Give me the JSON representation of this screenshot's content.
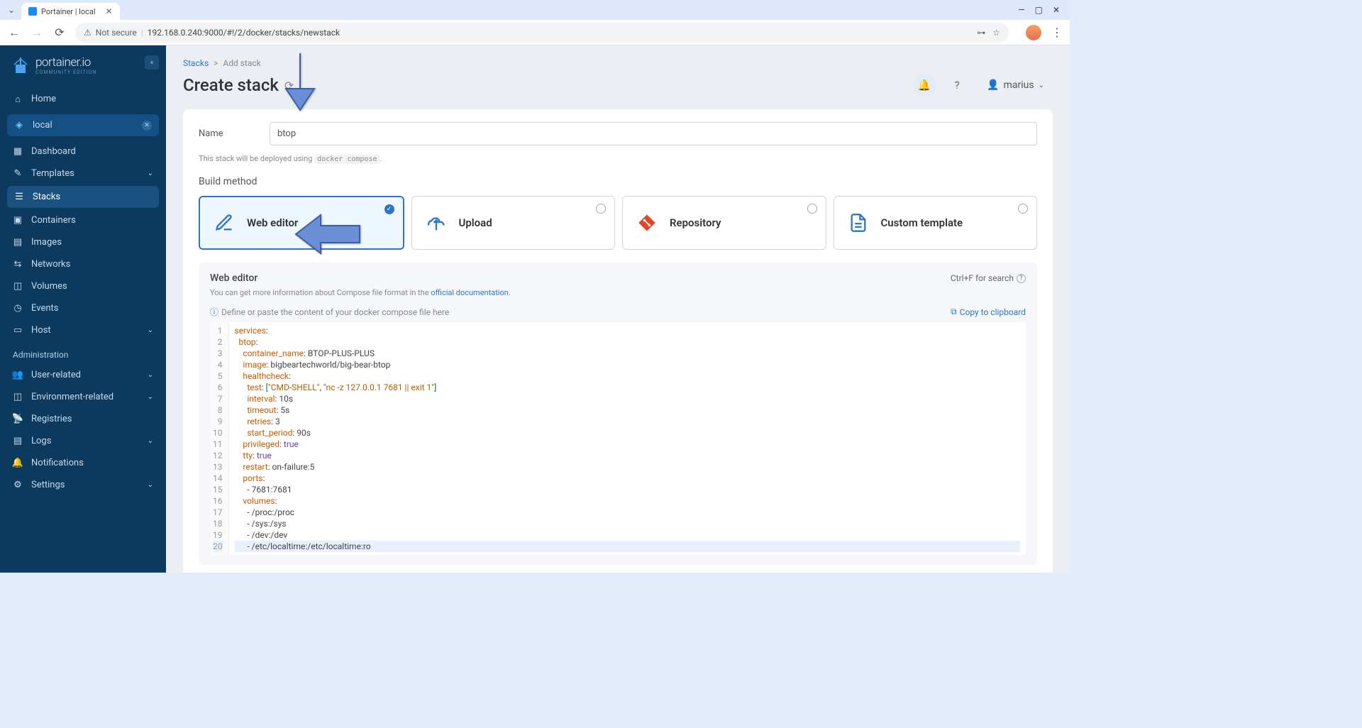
{
  "browser": {
    "tab_title": "Portainer | local",
    "security_label": "Not secure",
    "url": "192.168.0.240:9000/#!/2/docker/stacks/newstack"
  },
  "sidebar": {
    "brand": "portainer.io",
    "brand_sub": "COMMUNITY EDITION",
    "home": "Home",
    "env_name": "local",
    "items": [
      {
        "icon": "grid",
        "label": "Dashboard"
      },
      {
        "icon": "edit",
        "label": "Templates",
        "chevron": true
      },
      {
        "icon": "layers",
        "label": "Stacks",
        "active": true
      },
      {
        "icon": "boxes",
        "label": "Containers"
      },
      {
        "icon": "image",
        "label": "Images"
      },
      {
        "icon": "network",
        "label": "Networks"
      },
      {
        "icon": "db",
        "label": "Volumes"
      },
      {
        "icon": "clock",
        "label": "Events"
      },
      {
        "icon": "server",
        "label": "Host",
        "chevron": true
      }
    ],
    "admin_label": "Administration",
    "admin_items": [
      {
        "icon": "users",
        "label": "User-related",
        "chevron": true
      },
      {
        "icon": "globe",
        "label": "Environment-related",
        "chevron": true
      },
      {
        "icon": "radio",
        "label": "Registries"
      },
      {
        "icon": "file",
        "label": "Logs"
      },
      {
        "icon": "bell",
        "label": "Notifications"
      },
      {
        "icon": "gear",
        "label": "Settings",
        "chevron": true
      }
    ]
  },
  "breadcrumb": {
    "root": "Stacks",
    "sep": ">",
    "leaf": "Add stack"
  },
  "page": {
    "title": "Create stack",
    "user": "marius",
    "name_label": "Name",
    "name_value": "btop",
    "hint_prefix": "This stack will be deployed using ",
    "hint_code": "docker compose",
    "hint_suffix": ".",
    "build_method": "Build method",
    "methods": {
      "web_editor": "Web editor",
      "upload": "Upload",
      "repo": "Repository",
      "template": "Custom template"
    },
    "editor": {
      "title": "Web editor",
      "search_hint": "Ctrl+F for search",
      "desc_prefix": "You can get more information about Compose file format in the ",
      "desc_link": "official documentation",
      "desc_suffix": ".",
      "placeholder_hint": "Define or paste the content of your docker compose file here",
      "copy_label": "Copy to clipboard"
    }
  },
  "code": {
    "lines": [
      "services:",
      "  btop:",
      "    container_name: BTOP-PLUS-PLUS",
      "    image: bigbeartechworld/big-bear-btop",
      "    healthcheck:",
      "      test: [\"CMD-SHELL\", \"nc -z 127.0.0.1 7681 || exit 1\"]",
      "      interval: 10s",
      "      timeout: 5s",
      "      retries: 3",
      "      start_period: 90s",
      "    privileged: true",
      "    tty: true",
      "    restart: on-failure:5",
      "    ports:",
      "      - 7681:7681",
      "    volumes:",
      "      - /proc:/proc",
      "      - /sys:/sys",
      "      - /dev:/dev",
      "      - /etc/localtime:/etc/localtime:ro"
    ]
  }
}
